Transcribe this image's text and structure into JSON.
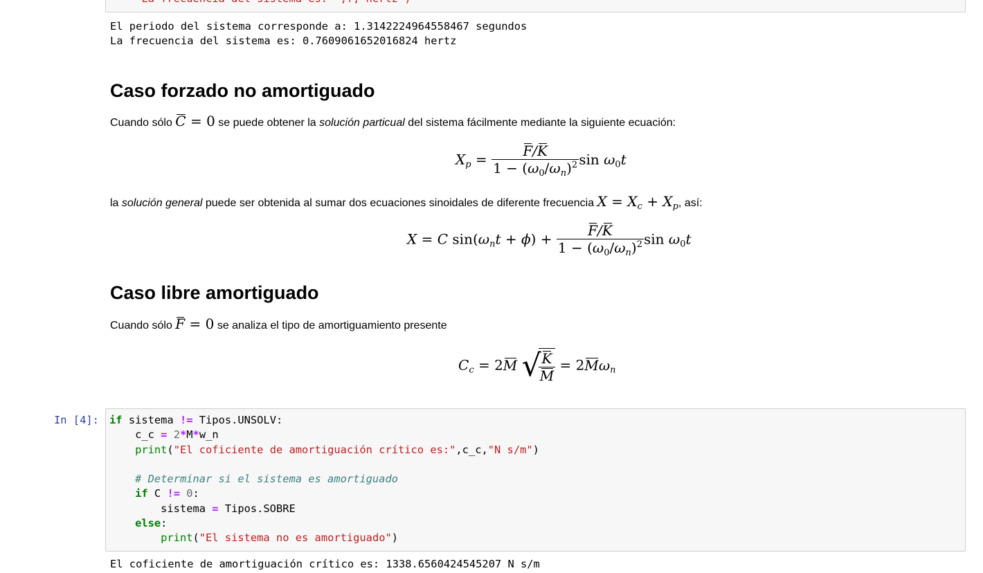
{
  "top_cell": {
    "partial_code": "    \"La frecuencia del sistema es: \",f,\"hertz\")"
  },
  "output1": {
    "lines": [
      "El periodo del sistema corresponde a: 1.3142224964558467 segundos",
      "La frecuencia del sistema es: 0.7609061652016824 hertz"
    ]
  },
  "section_forced": {
    "title": "Caso forzado no amortiguado",
    "p1_before": "Cuando sólo ",
    "p1_after": " se puede obtener la ",
    "p1_em": "solución particual",
    "p1_end": " del sistema fácilmente mediante la siguiente ecuación:",
    "p2_before": "la ",
    "p2_em": "solución general",
    "p2_mid": " puede ser obtenida al sumar dos ecuaciones sinoidales de diferente frecuencia ",
    "p2_end": ", así:"
  },
  "section_free": {
    "title": "Caso libre amortiguado",
    "p1_before": "Cuando sólo ",
    "p1_after": " se analiza el tipo de amortiguamiento presente"
  },
  "cell4": {
    "prompt": "In [4]:",
    "output": "El coficiente de amortiguación crítico es: 1338.6560424545207 N s/m"
  }
}
